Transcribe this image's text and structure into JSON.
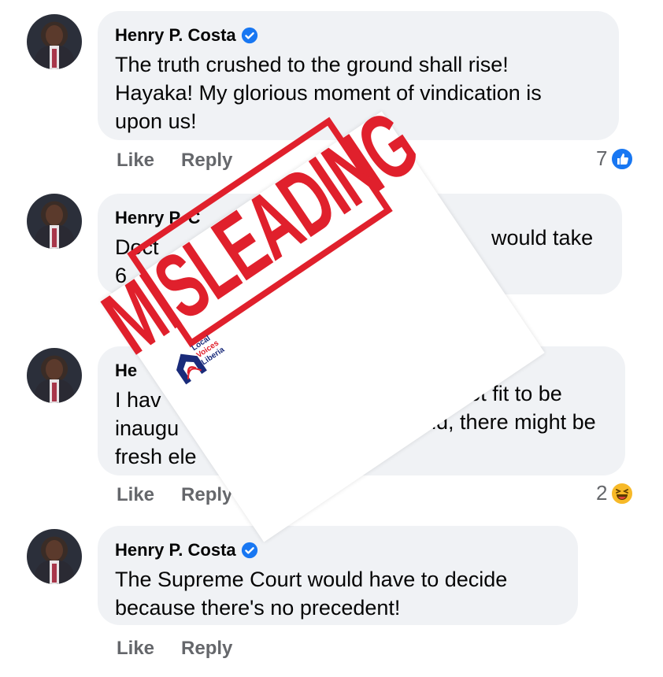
{
  "comments": [
    {
      "author": "Henry P. Costa",
      "text": [
        "The truth crushed to the ground shall rise!",
        "Hayaka! My glorious moment of vindication is",
        "upon us!"
      ],
      "like": "Like",
      "reply": "Reply",
      "reaction_count": "7",
      "reaction_icon": "thumbs-up-icon"
    },
    {
      "author": "Henry P. C",
      "text": [
        "Doct",
        "6"
      ],
      "text_right": "would take",
      "like": "",
      "reply": ""
    },
    {
      "author": "He",
      "text": [
        "I hav",
        "inaugu",
        "fresh ele"
      ],
      "text_right": [
        "ne's not fit to be",
        "2nd, there might be"
      ],
      "like": "Like",
      "reply": "Reply",
      "reaction_count": "2",
      "reaction_icon": "laughing-emoji-icon"
    },
    {
      "author": "Henry P. Costa",
      "text": [
        "The Supreme Court would have to decide",
        "because there's no precedent!"
      ],
      "like": "Like",
      "reply": "Reply"
    }
  ],
  "stamp": {
    "label": "MISLEADING",
    "color": "#e0202c",
    "logo_lines": [
      "Local",
      "Voices",
      "Liberia"
    ]
  },
  "colors": {
    "bubble": "#f0f2f5",
    "verified": "#1877f2",
    "meta_text": "#65676b"
  }
}
